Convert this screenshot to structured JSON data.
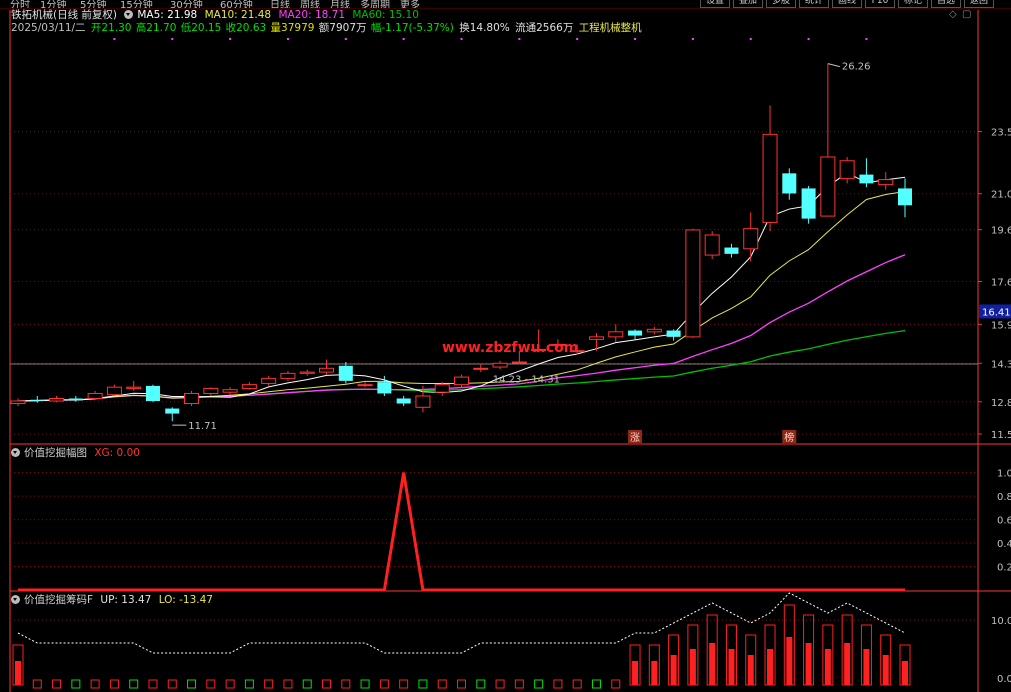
{
  "toolbar": {
    "items": [
      "分时",
      "1分钟",
      "5分钟",
      "15分钟",
      "30分钟",
      "60分钟",
      "日线",
      "周线",
      "月线",
      "多周期",
      "更多"
    ],
    "tabs": [
      "设置",
      "叠加",
      "多股",
      "统计",
      "画线",
      "F10",
      "标记",
      "自选",
      "返回"
    ]
  },
  "stock": {
    "name": "铁拓机械",
    "period": "(日线 前复权)"
  },
  "ma_header": {
    "ma5": "MA5: 21.98",
    "ma10": "MA10: 21.48",
    "ma20": "MA20: 18.71",
    "ma60": "MA60: 15.10"
  },
  "quote": {
    "date": "2025/03/11/二",
    "open": "开21.30",
    "high": "高21.70",
    "low": "低20.15",
    "close": "收20.63",
    "volume": "量37979",
    "amount": "额7907万",
    "change": "幅-1.17(-5.37%)",
    "turnover": "换14.80%",
    "float": "流通2566万",
    "industry": "工程机械整机"
  },
  "watermark": "www.zbzfwu.com",
  "colors": {
    "up": "#ff3232",
    "down": "#54ffff",
    "ma5": "#ffffff",
    "ma10": "#e8e84a",
    "ma20": "#ff40ff",
    "ma60": "#00c000",
    "grid": "#7a1010",
    "axis": "#ff3232"
  },
  "panel2": {
    "title": "价值挖掘幅图",
    "value_label": "XG: 0.00"
  },
  "panel3": {
    "title": "价值挖掘筹码F",
    "up_label": "UP: 13.47",
    "lo_label": "LO: -13.47"
  },
  "markers": {
    "up_tag": "涨",
    "other_tag": "榜"
  },
  "chart_data": [
    {
      "type": "candlestick",
      "title": "铁拓机械 (日线 前复权)",
      "ylim": [
        11.3,
        27.2
      ],
      "y_ticks": [
        "23.56",
        "21.09",
        "19.66",
        "17.60",
        "15.90",
        "14.35",
        "12.82",
        "11.54"
      ],
      "current_price": "16.41",
      "annotations": [
        "26.26",
        "11.71",
        "14.23 - 14.31"
      ],
      "candles": [
        {
          "o": 12.75,
          "c": 12.85,
          "h": 12.95,
          "l": 12.65
        },
        {
          "o": 12.9,
          "c": 12.88,
          "h": 13.05,
          "l": 12.78
        },
        {
          "o": 12.85,
          "c": 12.95,
          "h": 13.05,
          "l": 12.8
        },
        {
          "o": 12.95,
          "c": 12.88,
          "h": 13.05,
          "l": 12.82
        },
        {
          "o": 12.95,
          "c": 13.15,
          "h": 13.25,
          "l": 12.9
        },
        {
          "o": 13.1,
          "c": 13.4,
          "h": 13.5,
          "l": 13.05
        },
        {
          "o": 13.35,
          "c": 13.4,
          "h": 13.65,
          "l": 13.25
        },
        {
          "o": 13.45,
          "c": 12.85,
          "h": 13.5,
          "l": 12.8
        },
        {
          "o": 12.55,
          "c": 12.35,
          "h": 12.6,
          "l": 12.05
        },
        {
          "o": 12.75,
          "c": 13.15,
          "h": 13.25,
          "l": 12.65
        },
        {
          "o": 13.15,
          "c": 13.35,
          "h": 13.4,
          "l": 13.05
        },
        {
          "o": 13.2,
          "c": 13.3,
          "h": 13.4,
          "l": 13.1
        },
        {
          "o": 13.35,
          "c": 13.5,
          "h": 13.6,
          "l": 13.3
        },
        {
          "o": 13.55,
          "c": 13.75,
          "h": 13.85,
          "l": 13.45
        },
        {
          "o": 13.75,
          "c": 13.95,
          "h": 14.05,
          "l": 13.65
        },
        {
          "o": 13.95,
          "c": 14.0,
          "h": 14.1,
          "l": 13.85
        },
        {
          "o": 14.0,
          "c": 14.15,
          "h": 14.5,
          "l": 13.9
        },
        {
          "o": 14.25,
          "c": 13.65,
          "h": 14.4,
          "l": 13.55
        },
        {
          "o": 13.5,
          "c": 13.5,
          "h": 13.6,
          "l": 13.4
        },
        {
          "o": 13.6,
          "c": 13.15,
          "h": 13.85,
          "l": 13.05
        },
        {
          "o": 12.95,
          "c": 12.75,
          "h": 13.05,
          "l": 12.65
        },
        {
          "o": 12.6,
          "c": 13.05,
          "h": 13.45,
          "l": 12.4
        },
        {
          "o": 13.2,
          "c": 13.5,
          "h": 13.6,
          "l": 13.05
        },
        {
          "o": 13.5,
          "c": 13.8,
          "h": 13.9,
          "l": 13.4
        },
        {
          "o": 14.15,
          "c": 14.15,
          "h": 14.3,
          "l": 14.0
        },
        {
          "o": 14.2,
          "c": 14.35,
          "h": 14.45,
          "l": 14.1
        },
        {
          "o": 14.4,
          "c": 14.4,
          "h": 14.85,
          "l": 14.3
        },
        {
          "o": 14.9,
          "c": 14.9,
          "h": 15.7,
          "l": 14.8
        },
        {
          "o": 15.1,
          "c": 15.1,
          "h": 15.3,
          "l": 14.95
        },
        {
          "o": 14.85,
          "c": 14.85,
          "h": 15.1,
          "l": 14.7
        },
        {
          "o": 15.3,
          "c": 15.4,
          "h": 15.55,
          "l": 14.85
        },
        {
          "o": 15.4,
          "c": 15.6,
          "h": 15.9,
          "l": 15.2
        },
        {
          "o": 15.65,
          "c": 15.45,
          "h": 15.7,
          "l": 15.3
        },
        {
          "o": 15.6,
          "c": 15.7,
          "h": 15.8,
          "l": 15.5
        },
        {
          "o": 15.65,
          "c": 15.4,
          "h": 15.7,
          "l": 15.25
        },
        {
          "o": 15.4,
          "c": 19.65,
          "h": 19.7,
          "l": 15.35
        },
        {
          "o": 18.65,
          "c": 19.45,
          "h": 19.6,
          "l": 18.5
        },
        {
          "o": 18.95,
          "c": 18.7,
          "h": 19.1,
          "l": 18.55
        },
        {
          "o": 18.9,
          "c": 19.7,
          "h": 20.35,
          "l": 18.4
        },
        {
          "o": 19.95,
          "c": 23.45,
          "h": 24.6,
          "l": 19.6
        },
        {
          "o": 21.9,
          "c": 21.1,
          "h": 22.1,
          "l": 20.85
        },
        {
          "o": 21.3,
          "c": 20.1,
          "h": 21.4,
          "l": 19.9
        },
        {
          "o": 20.2,
          "c": 22.55,
          "h": 26.26,
          "l": 20.2
        },
        {
          "o": 21.7,
          "c": 22.4,
          "h": 22.55,
          "l": 21.5
        },
        {
          "o": 21.85,
          "c": 21.5,
          "h": 22.5,
          "l": 21.35
        },
        {
          "o": 21.45,
          "c": 21.65,
          "h": 21.95,
          "l": 21.25
        },
        {
          "o": 21.3,
          "c": 20.63,
          "h": 21.7,
          "l": 20.15
        }
      ]
    },
    {
      "type": "line",
      "title": "价值挖掘幅图",
      "series": [
        {
          "name": "XG",
          "values": [
            0,
            0,
            0,
            0,
            0,
            0,
            0,
            0,
            0,
            0,
            0,
            0,
            0,
            0,
            0,
            0,
            0,
            0,
            0,
            0,
            1,
            0,
            0,
            0,
            0,
            0,
            0,
            0,
            0,
            0,
            0,
            0,
            0,
            0,
            0,
            0,
            0,
            0,
            0,
            0,
            0,
            0,
            0,
            0,
            0,
            0,
            0
          ]
        }
      ],
      "ylim": [
        0,
        1.15
      ],
      "y_ticks": [
        "1.00",
        "0.80",
        "0.60",
        "0.40",
        "0.20"
      ]
    },
    {
      "type": "bar",
      "title": "价值挖掘筹码F",
      "series": [
        {
          "name": "UP",
          "values": [
            4,
            3,
            3,
            3,
            3,
            3,
            3,
            2,
            2,
            2,
            2,
            2,
            3,
            3,
            3,
            3,
            3,
            3,
            3,
            2,
            2,
            2,
            2,
            2,
            3,
            3,
            3,
            3,
            3,
            3,
            3,
            3,
            4,
            4,
            5,
            6,
            7,
            6,
            5,
            6,
            8,
            7,
            6,
            7,
            6,
            5,
            4
          ]
        },
        {
          "name": "LO",
          "values": [
            -2,
            -2,
            -2,
            -2,
            -2,
            -1,
            -1,
            -1,
            -1,
            -1,
            -1,
            -1,
            -1,
            -1,
            -1,
            -1,
            -1,
            -1,
            -1,
            -1,
            -1,
            -1,
            -1,
            -1,
            -1,
            -1,
            -1,
            -1,
            -1,
            -1,
            -1,
            -1,
            -1,
            -1,
            -1,
            -1,
            -1,
            -1,
            -1,
            -1,
            -1,
            -1,
            -1,
            -1,
            -1,
            -1,
            -1
          ]
        }
      ],
      "ylim": [
        0,
        13.5
      ],
      "y_ticks": [
        "10.00",
        "0.00"
      ]
    }
  ]
}
